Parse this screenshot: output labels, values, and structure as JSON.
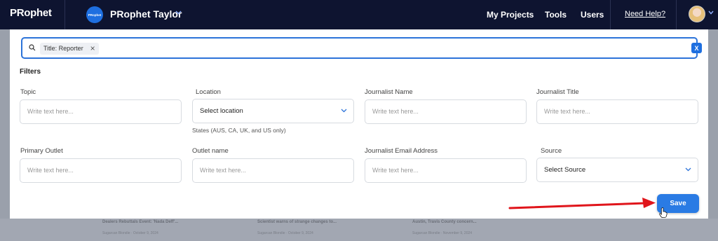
{
  "topbar": {
    "logo": "PRophet",
    "account_badge": "PRophet",
    "account_name": "PRophet Taylor",
    "nav": [
      "My Projects",
      "Tools",
      "Users"
    ],
    "help": "Need Help?"
  },
  "search": {
    "chip_label": "Title: Reporter",
    "clear_label": "X"
  },
  "filters": {
    "heading": "Filters",
    "fields": [
      {
        "label": "Topic",
        "placeholder": "Write text here..."
      },
      {
        "label": "Location",
        "value": "Select location",
        "hint": "States (AUS, CA, UK, and US only)"
      },
      {
        "label": "Journalist Name",
        "placeholder": "Write text here..."
      },
      {
        "label": "Journalist Title",
        "placeholder": "Write text here..."
      },
      {
        "label": "Primary Outlet",
        "placeholder": "Write text here..."
      },
      {
        "label": "Outlet name",
        "placeholder": "Write text here..."
      },
      {
        "label": "Journalist Email Address",
        "placeholder": "Write text here..."
      },
      {
        "label": "Source",
        "value": "Select Source"
      }
    ]
  },
  "save_label": "Save",
  "background_cards": [
    {
      "title": "Dealers Rebuttals Event: 'Nada Deff'...",
      "sub": "Sugarcan Blondie · October 9, 2024"
    },
    {
      "title": "Scientist warns of strange changes to...",
      "sub": "Sugarcan Blondie · October 9, 2024"
    },
    {
      "title": "Austin, Travis County concern...",
      "sub": "Sugarcan Blondie · November 9, 2024"
    }
  ],
  "colors": {
    "nav_bg": "#0e1430",
    "accent": "#1e6fe0",
    "arrow": "#e0151b"
  }
}
